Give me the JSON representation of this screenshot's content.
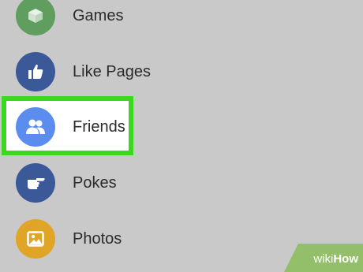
{
  "colors": {
    "background": "#c9c9c9",
    "highlight_border": "#3bd81f",
    "games_icon_bg": "#5f9e5f",
    "like_pages_icon_bg": "#3b5998",
    "friends_icon_bg": "#5b8def",
    "pokes_icon_bg": "#3b5998",
    "photos_icon_bg": "#e0a526",
    "watermark_bg": "#93be6a"
  },
  "menu": {
    "items": [
      {
        "label": "Games",
        "icon": "cube-icon"
      },
      {
        "label": "Like Pages",
        "icon": "thumbs-up-icon"
      },
      {
        "label": "Friends",
        "icon": "friends-icon"
      },
      {
        "label": "Pokes",
        "icon": "pointing-hand-icon"
      },
      {
        "label": "Photos",
        "icon": "photo-icon"
      }
    ]
  },
  "watermark": {
    "wiki": "wiki",
    "how": "How"
  }
}
